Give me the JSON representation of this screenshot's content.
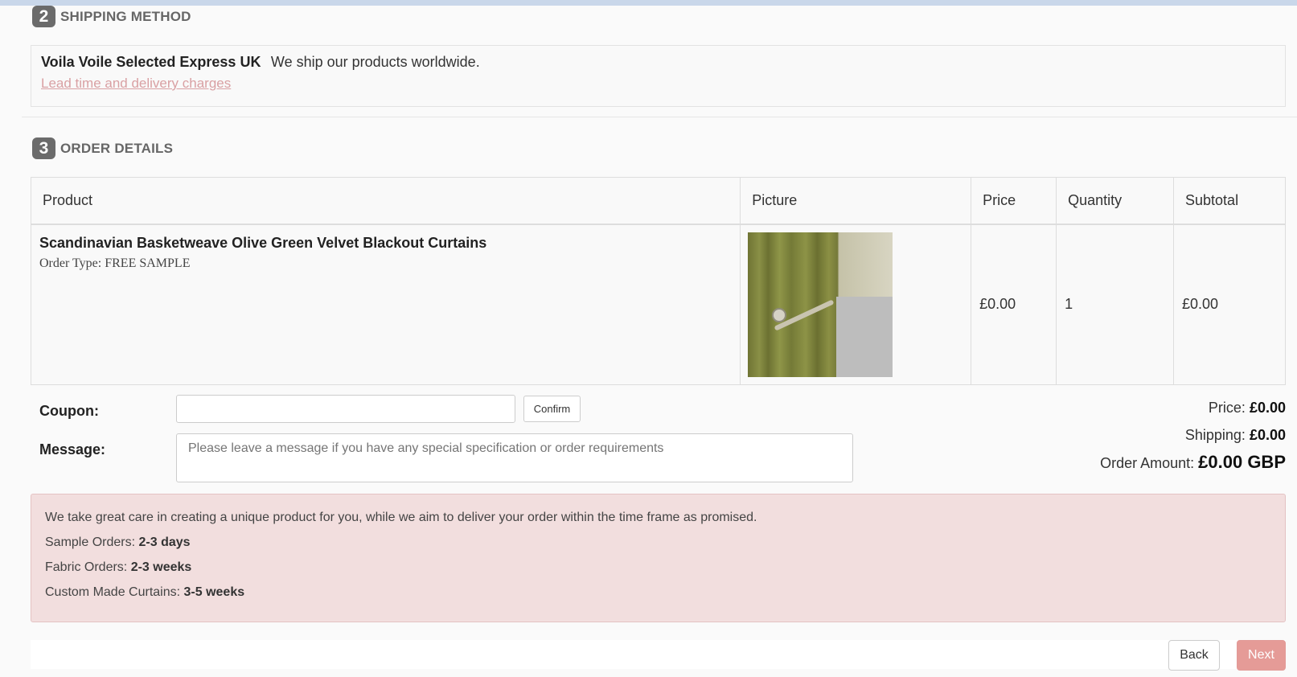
{
  "shipping": {
    "step": "2",
    "title": "SHIPPING METHOD",
    "method_name": "Voila Voile Selected Express UK",
    "method_desc": "We ship our products worldwide.",
    "link": "Lead time and delivery charges"
  },
  "order": {
    "step": "3",
    "title": "ORDER DETAILS",
    "columns": [
      "Product",
      "Picture",
      "Price",
      "Quantity",
      "Subtotal"
    ],
    "rows": [
      {
        "product": "Scandinavian Basketweave Olive Green Velvet Blackout Curtains",
        "order_type": "Order Type: FREE SAMPLE",
        "picture_icon": "curtain-product-photo",
        "price": "£0.00",
        "quantity": "1",
        "subtotal": "£0.00"
      }
    ]
  },
  "form": {
    "coupon_label": "Coupon:",
    "coupon_value": "",
    "confirm_label": "Confirm",
    "message_label": "Message:",
    "message_placeholder": "Please leave a message if you have any special specification or order requirements"
  },
  "totals": {
    "price_label": "Price:",
    "price_value": "£0.00",
    "shipping_label": "Shipping:",
    "shipping_value": "£0.00",
    "amount_label": "Order Amount:",
    "amount_value": "£0.00 GBP"
  },
  "notice": {
    "intro": "We take great care in creating a unique product for you, while we aim to deliver your order within the time frame as promised.",
    "lines": [
      {
        "label": "Sample Orders:",
        "value": "2-3 days"
      },
      {
        "label": "Fabric Orders:",
        "value": "2-3 weeks"
      },
      {
        "label": "Custom Made Curtains:",
        "value": "3-5 weeks"
      }
    ]
  },
  "nav": {
    "back_label": "Back",
    "next_label": "Next"
  },
  "colors": {
    "accent_link": "#d9a0a3",
    "next_button": "#e59b97",
    "notice_bg": "#f2dede",
    "badge_bg": "#6b6b6b"
  }
}
